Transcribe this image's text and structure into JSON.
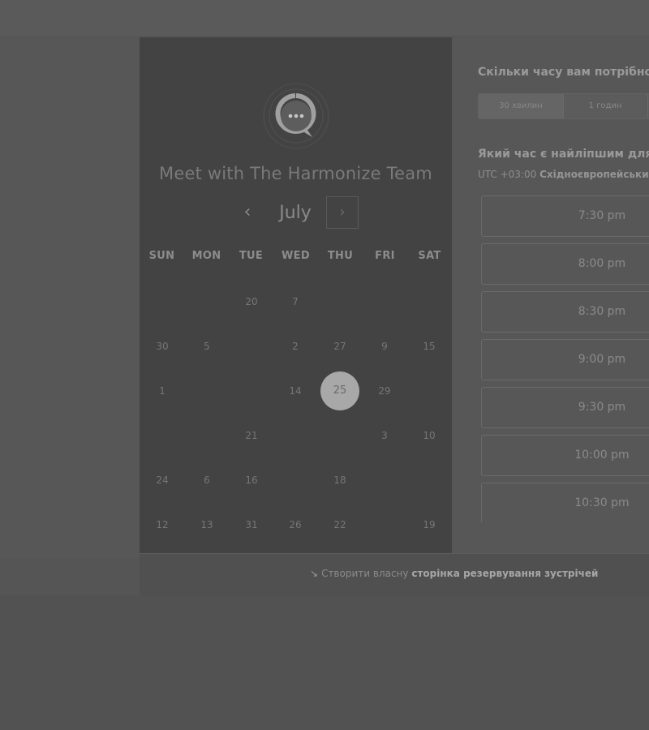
{
  "calendar": {
    "title": "Meet with The Harmonize Team",
    "month": "July",
    "prev_icon": "‹",
    "next_icon": "›",
    "weekdays": [
      "SUN",
      "MON",
      "TUE",
      "WED",
      "THU",
      "FRI",
      "SAT"
    ],
    "days": [
      [
        "",
        "",
        "20",
        "7",
        "",
        "",
        ""
      ],
      [
        "30",
        "5",
        "",
        "2",
        "27",
        "9",
        "15"
      ],
      [
        "1",
        "",
        "",
        "14",
        "25",
        "29",
        ""
      ],
      [
        "",
        "",
        "21",
        "",
        "",
        "3",
        "10"
      ],
      [
        "24",
        "6",
        "16",
        "",
        "18",
        "",
        ""
      ],
      [
        "12",
        "13",
        "31",
        "26",
        "22",
        "",
        "19"
      ]
    ],
    "selected_day": "25"
  },
  "booking": {
    "duration_question": "Скільки часу вам потрібно?",
    "duration_options": [
      "30 хвилин",
      "1 годин"
    ],
    "time_question": "Який час є найліпшим для в",
    "timezone_offset": "UTC +03:00",
    "timezone_name": "Східноєвропейськи",
    "time_slots": [
      "7:30 pm",
      "8:00 pm",
      "8:30 pm",
      "9:00 pm",
      "9:30 pm",
      "10:00 pm",
      "10:30 pm"
    ]
  },
  "footer": {
    "prefix": "Створити власну",
    "link": "сторінка резервування зустрічей"
  },
  "colors": {
    "overlay": "#555555",
    "calendar_panel": "#434343",
    "selected_day": "#a8a8a8"
  }
}
